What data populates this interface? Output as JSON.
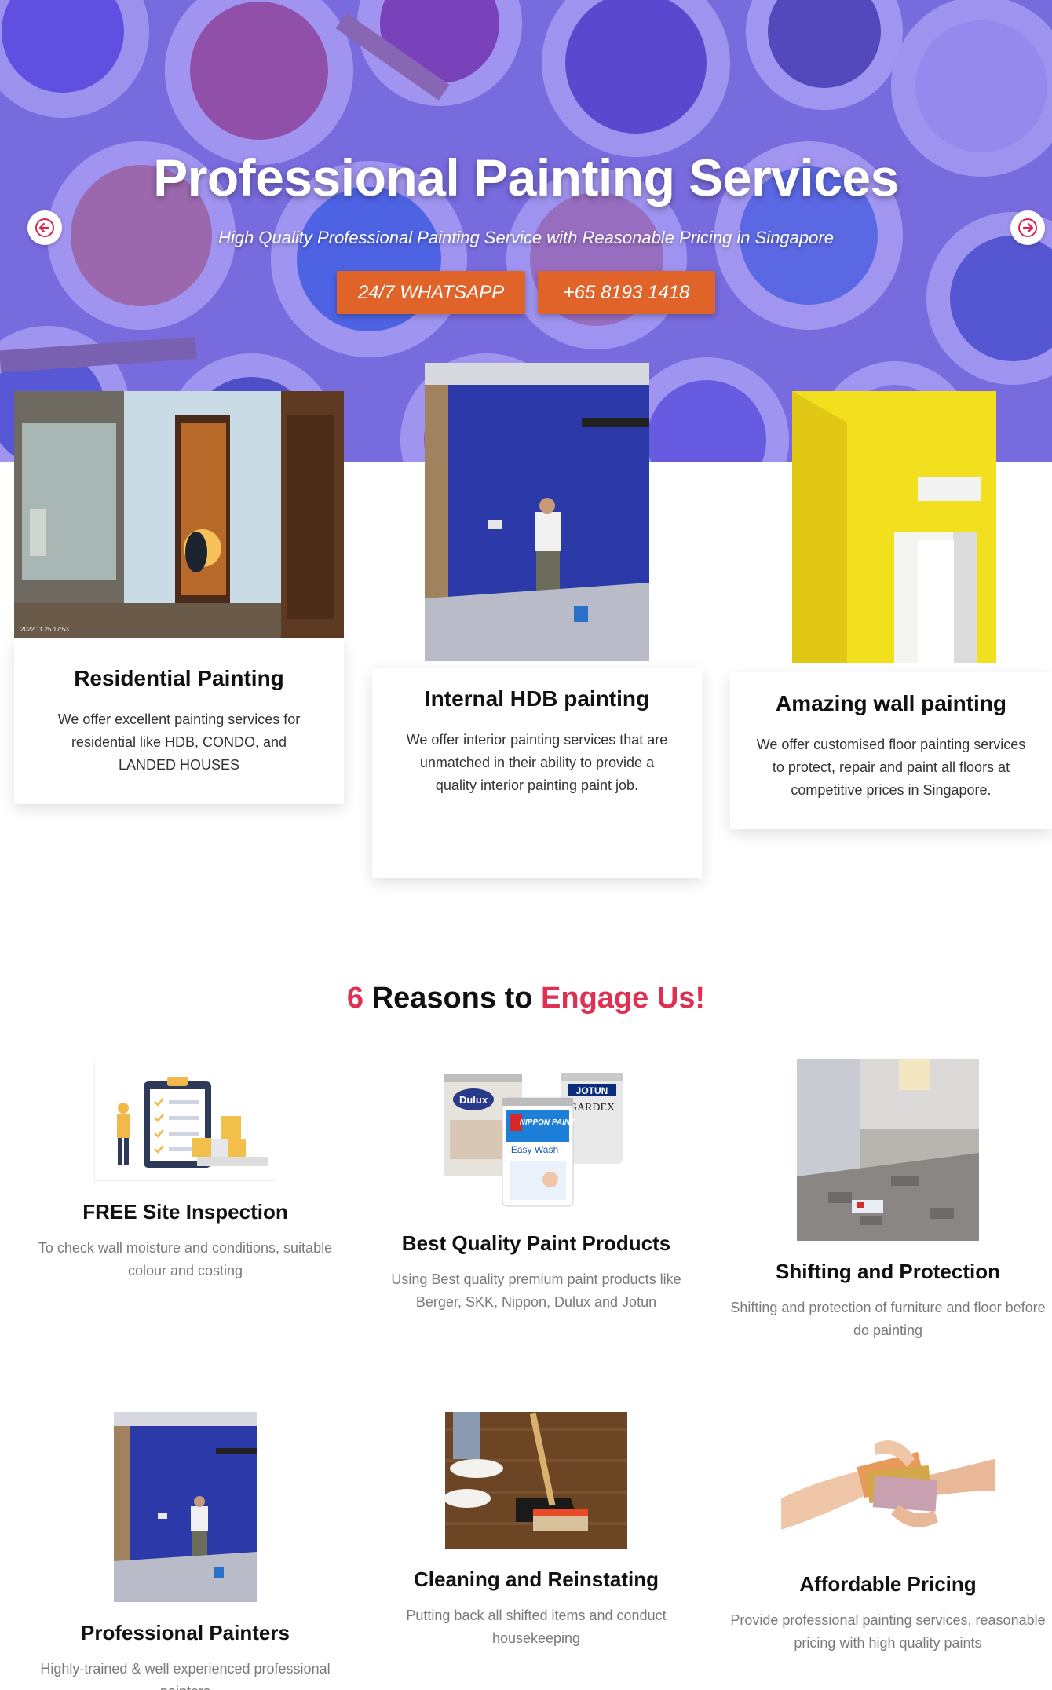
{
  "hero": {
    "title": "Professional Painting Services",
    "subtitle": "High Quality Professional Painting Service with Reasonable Pricing in Singapore",
    "whatsapp_button": "24/7 WHATSAPP",
    "phone_button": "+65 8193 1418"
  },
  "services": [
    {
      "title": "Residential Painting",
      "text": "We offer excellent painting services for residential like HDB, CONDO, and LANDED HOUSES",
      "image_stamp": "2022.11.25 17:53"
    },
    {
      "title": "Internal HDB painting",
      "text": "We offer interior painting services that are unmatched in their ability to provide a quality interior painting paint job."
    },
    {
      "title": "Amazing wall painting",
      "text": "We offer customised floor painting services to protect, repair and paint all floors at competitive prices in Singapore."
    }
  ],
  "reasons_heading": {
    "number": "6",
    "middle": " Reasons to ",
    "accent": "Engage Us!"
  },
  "reasons": [
    {
      "title": "FREE Site Inspection",
      "text": "To check wall moisture and conditions, suitable colour and costing"
    },
    {
      "title": "Best Quality Paint Products",
      "text": "Using Best quality premium paint products like Berger, SKK, Nippon, Dulux and Jotun"
    },
    {
      "title": "Shifting and Protection",
      "text": "Shifting and protection of furniture and floor before do painting"
    },
    {
      "title": "Professional Painters",
      "text": "Highly-trained & well experienced professional painters"
    },
    {
      "title": "Cleaning and Reinstating",
      "text": "Putting back all shifted items and conduct housekeeping"
    },
    {
      "title": "Affordable Pricing",
      "text": "Provide professional painting services, reasonable pricing with high quality paints"
    }
  ],
  "paint_brands": {
    "dulux": "Dulux",
    "nippon": "NIPPON PAINT",
    "easywash": "Easy Wash",
    "jotun": "JOTUN",
    "gardex": "GARDEX"
  },
  "colors": {
    "accent_red": "#e03052",
    "button_orange": "#e0632a",
    "hero_overlay": "#6e5ceb",
    "wall_blue": "#2f3fb0",
    "wall_yellow": "#f2e01e"
  }
}
